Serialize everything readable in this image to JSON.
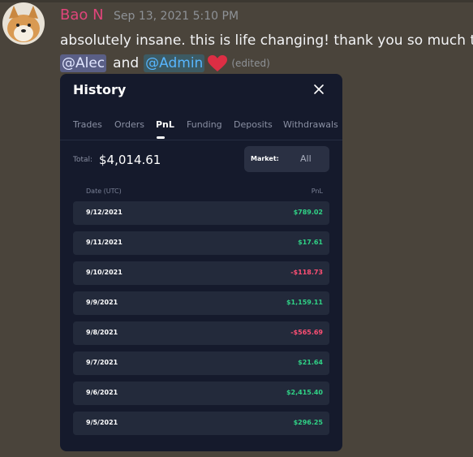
{
  "message": {
    "author": "Bao N",
    "timestamp": "Sep 13, 2021 5:10 PM",
    "line1": "absolutely insane. this is life changing! thank you so much to",
    "mention1": "@Alec",
    "conjunction": "and",
    "mention2": "@Admin",
    "emoji": "red-heart-icon",
    "edited": "(edited)"
  },
  "history": {
    "title": "History",
    "tabs": [
      "Trades",
      "Orders",
      "PnL",
      "Funding",
      "Deposits",
      "Withdrawals"
    ],
    "active_tab": "PnL",
    "total_label": "Total:",
    "total_value": "$4,014.61",
    "market_label": "Market:",
    "market_value": "All",
    "col_date": "Date (UTC)",
    "col_pnl": "PnL",
    "rows": [
      {
        "date": "9/12/2021",
        "pnl": "$789.02",
        "sign": "pos"
      },
      {
        "date": "9/11/2021",
        "pnl": "$17.61",
        "sign": "pos"
      },
      {
        "date": "9/10/2021",
        "pnl": "-$118.73",
        "sign": "neg"
      },
      {
        "date": "9/9/2021",
        "pnl": "$1,159.11",
        "sign": "pos"
      },
      {
        "date": "9/8/2021",
        "pnl": "-$565.69",
        "sign": "neg"
      },
      {
        "date": "9/7/2021",
        "pnl": "$21.64",
        "sign": "pos"
      },
      {
        "date": "9/6/2021",
        "pnl": "$2,415.40",
        "sign": "pos"
      },
      {
        "date": "9/5/2021",
        "pnl": "$296.25",
        "sign": "pos"
      }
    ]
  },
  "colors": {
    "positive": "#30d286",
    "negative": "#ff4f74",
    "author": "#e0457b"
  }
}
